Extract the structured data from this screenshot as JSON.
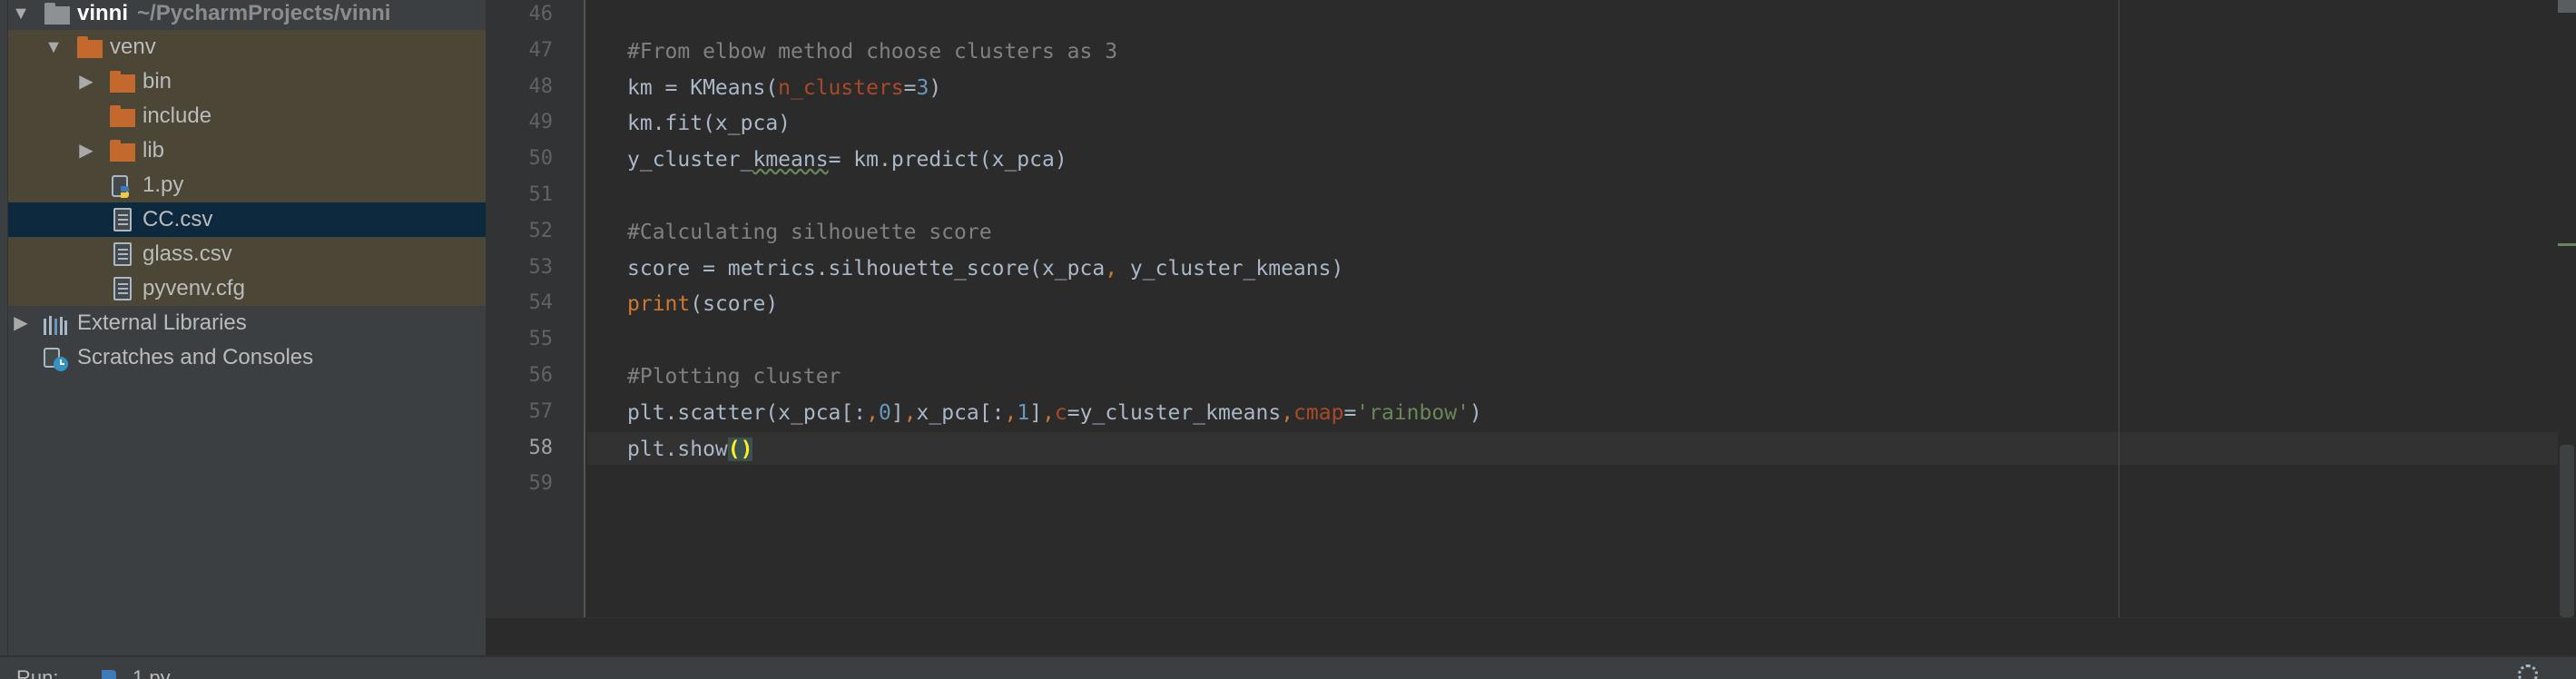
{
  "project_tree": {
    "root": {
      "label": "vinni",
      "path": "~/PycharmProjects/vinni"
    },
    "items": [
      {
        "label": "venv",
        "type": "folder"
      },
      {
        "label": "bin",
        "type": "folder"
      },
      {
        "label": "include",
        "type": "folder"
      },
      {
        "label": "lib",
        "type": "folder"
      },
      {
        "label": "1.py",
        "type": "python-file"
      },
      {
        "label": "CC.csv",
        "type": "csv-file",
        "selected": true
      },
      {
        "label": "glass.csv",
        "type": "csv-file"
      },
      {
        "label": "pyvenv.cfg",
        "type": "cfg-file"
      },
      {
        "label": "External Libraries",
        "type": "libraries"
      },
      {
        "label": "Scratches and Consoles",
        "type": "scratches"
      }
    ]
  },
  "editor": {
    "active_line": "58",
    "line_numbers": [
      "46",
      "47",
      "48",
      "49",
      "50",
      "51",
      "52",
      "53",
      "54",
      "55",
      "56",
      "57",
      "58",
      "59"
    ],
    "lines": [
      [],
      [
        {
          "t": "#From elbow method choose clusters as 3",
          "c": "comment"
        }
      ],
      [
        {
          "t": "km = KMeans("
        },
        {
          "t": "n_clusters",
          "c": "param"
        },
        {
          "t": "="
        },
        {
          "t": "3",
          "c": "num"
        },
        {
          "t": ")"
        }
      ],
      [
        {
          "t": "km.fit(x_pca)"
        }
      ],
      [
        {
          "t": "y_cluster_"
        },
        {
          "t": "kmeans",
          "c": "squiggle"
        },
        {
          "t": "= km.predict(x_pca)"
        }
      ],
      [],
      [
        {
          "t": "#Calculating silhouette score",
          "c": "comment"
        }
      ],
      [
        {
          "t": "score = metrics.silhouette_score(x_pca"
        },
        {
          "t": ",",
          "c": "kw-orange"
        },
        {
          "t": " y_cluster_kmeans)"
        }
      ],
      [
        {
          "t": "print",
          "c": "kw-orange"
        },
        {
          "t": "(score)"
        }
      ],
      [],
      [
        {
          "t": "#Plotting cluster",
          "c": "comment"
        }
      ],
      [
        {
          "t": "plt.scatter(x_pca[:"
        },
        {
          "t": ",",
          "c": "kw-orange"
        },
        {
          "t": "0",
          "c": "num"
        },
        {
          "t": "]"
        },
        {
          "t": ",",
          "c": "kw-orange"
        },
        {
          "t": "x_pca[:"
        },
        {
          "t": ",",
          "c": "kw-orange"
        },
        {
          "t": "1",
          "c": "num"
        },
        {
          "t": "]"
        },
        {
          "t": ",",
          "c": "kw-orange"
        },
        {
          "t": "c",
          "c": "param"
        },
        {
          "t": "=y_cluster_kmeans"
        },
        {
          "t": ",",
          "c": "kw-orange"
        },
        {
          "t": "cmap",
          "c": "param"
        },
        {
          "t": "="
        },
        {
          "t": "'rainbow'",
          "c": "str"
        },
        {
          "t": ")"
        }
      ],
      [
        {
          "t": "plt.show"
        },
        {
          "t": "()",
          "c": "paren-hl"
        }
      ],
      []
    ]
  },
  "bottom_bar": {
    "tab_label": "Run:",
    "file_label": "1.py"
  },
  "colors": {
    "background": "#2b2b2b",
    "panel": "#3c3f41",
    "selection": "#0d293e",
    "venv_highlight": "#4b4636",
    "folder_orange": "#c4692d",
    "comment": "#808080",
    "keyword": "#cc7832",
    "number": "#6897bb",
    "string": "#6a8759"
  }
}
